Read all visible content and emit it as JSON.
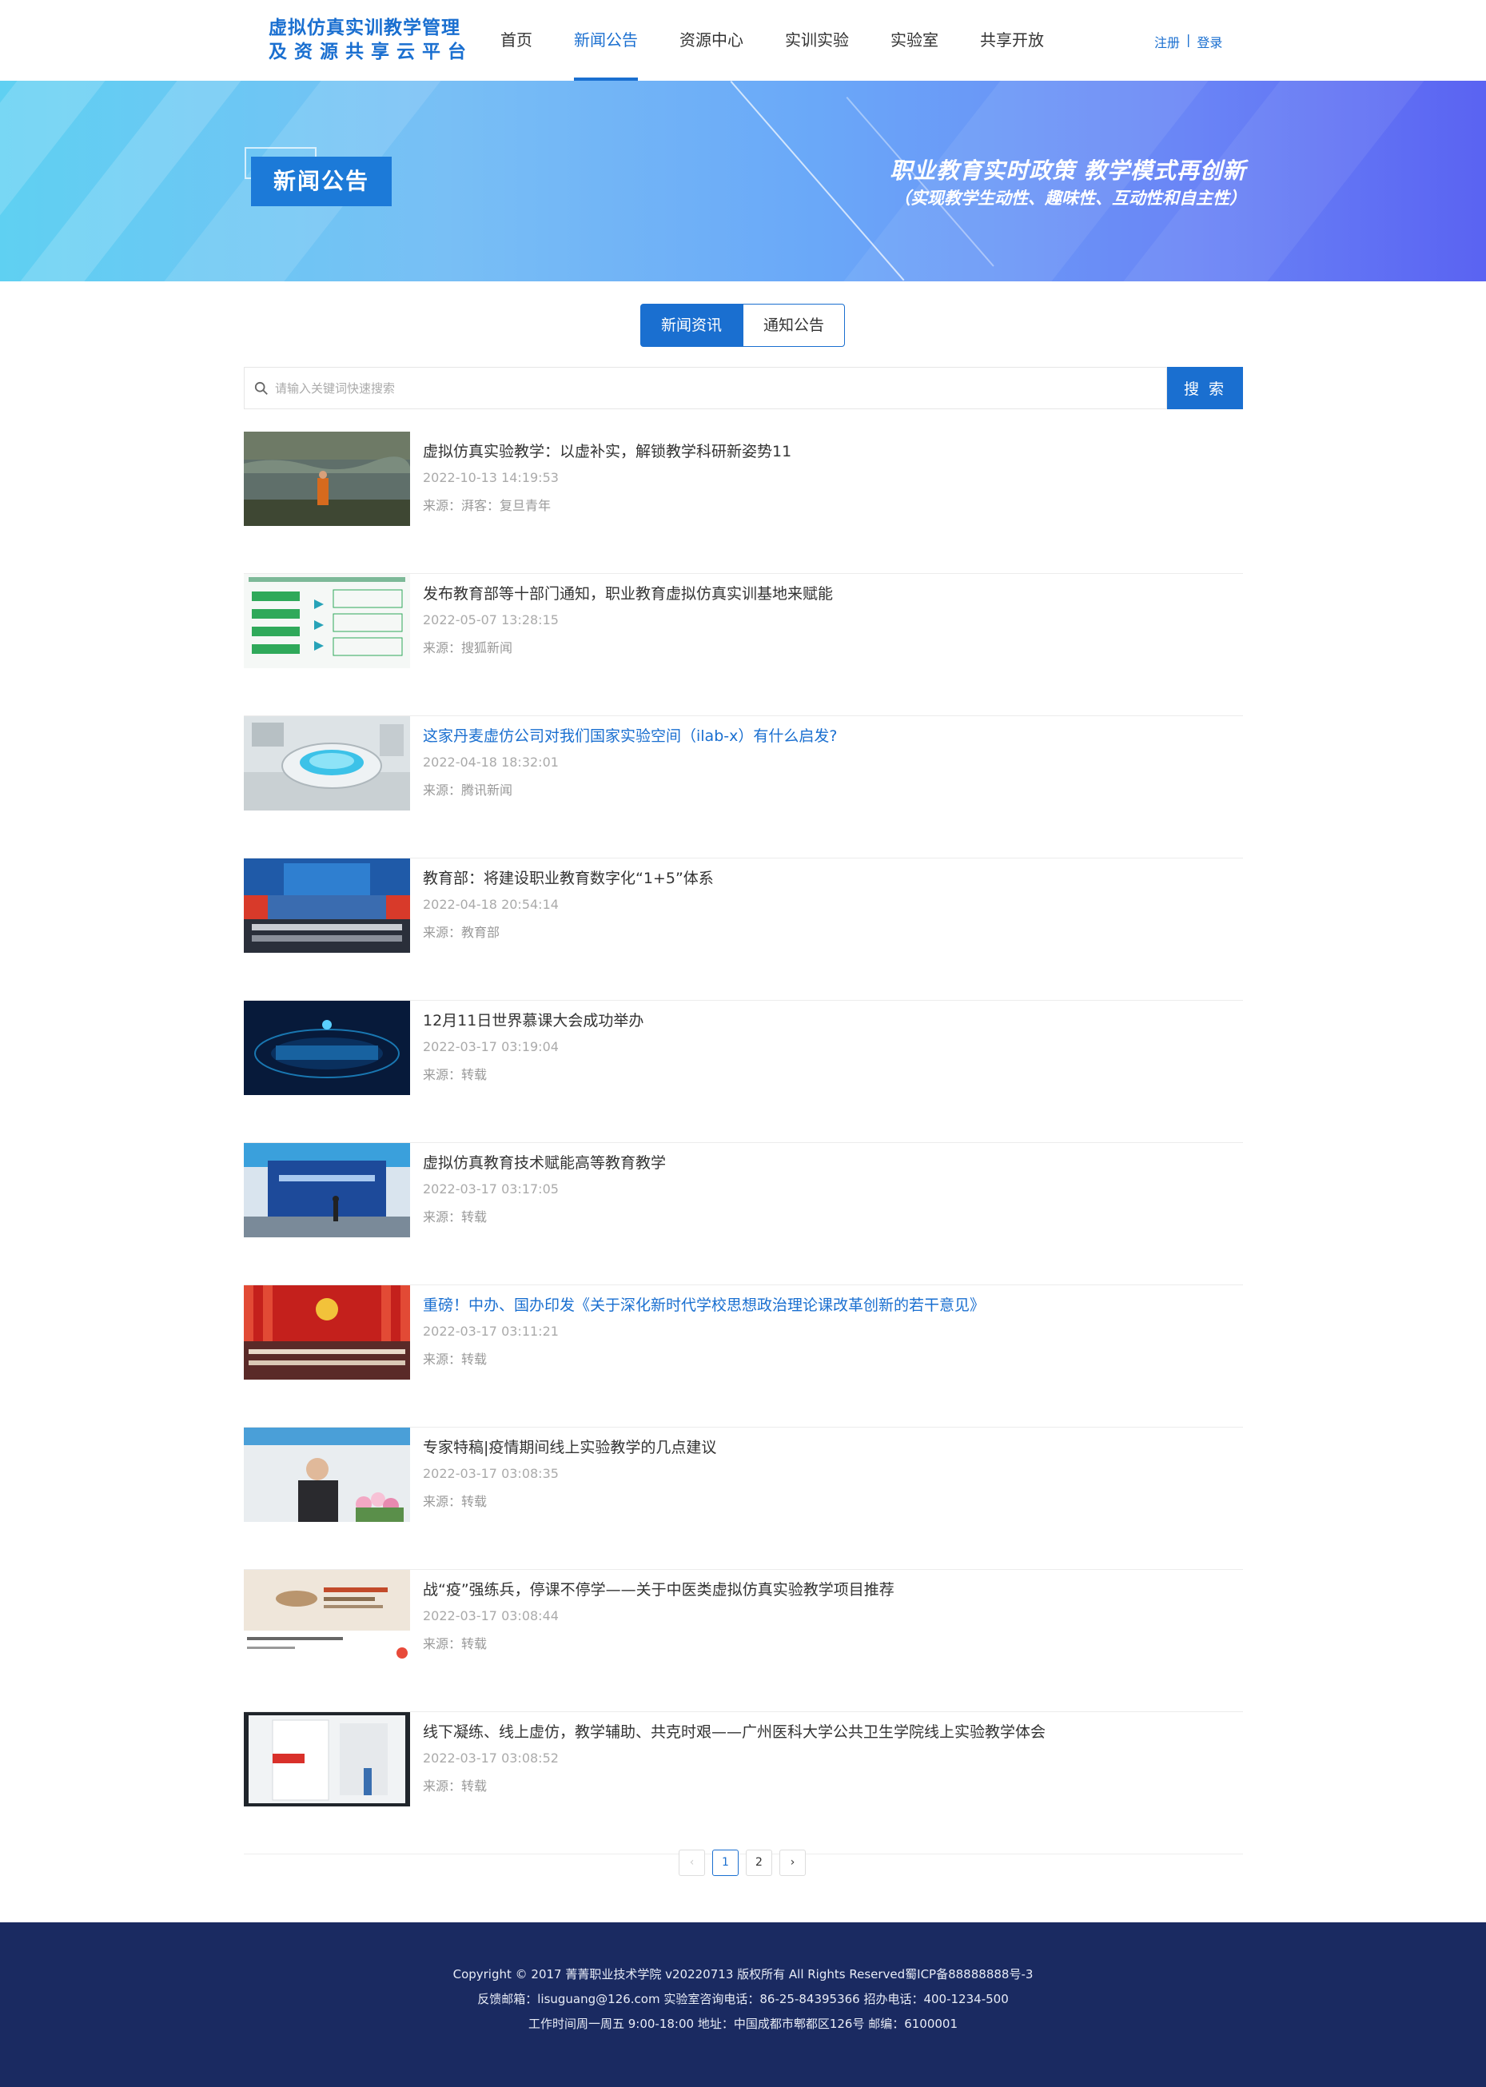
{
  "header": {
    "logo_line1": "虚拟仿真实训教学管理",
    "logo_line2": "及资源共享云平台",
    "nav": [
      {
        "label": "首页"
      },
      {
        "label": "新闻公告",
        "active": true
      },
      {
        "label": "资源中心"
      },
      {
        "label": "实训实验"
      },
      {
        "label": "实验室"
      },
      {
        "label": "共享开放"
      }
    ],
    "register": "注册",
    "separator": "|",
    "login": "登录"
  },
  "banner": {
    "tag": "新闻公告",
    "slogan_line1": "职业教育实时政策  教学模式再创新",
    "slogan_line2": "（实现教学生动性、趣味性、互动性和自主性）"
  },
  "tabs": {
    "news": "新闻资讯",
    "notice": "通知公告"
  },
  "search": {
    "placeholder": "请输入关键词快速搜索",
    "button": "搜 索"
  },
  "news_items": [
    {
      "title": "虚拟仿真实验教学：以虚补实，解锁教学科研新姿势11",
      "date": "2022-10-13 14:19:53",
      "source": "来源：湃客：复旦青年",
      "thumb": "lake-scene",
      "highlight": false
    },
    {
      "title": "发布教育部等十部门通知，职业教育虚拟仿真实训基地来赋能",
      "date": "2022-05-07 13:28:15",
      "source": "来源：搜狐新闻",
      "thumb": "flowchart",
      "highlight": false
    },
    {
      "title": "这家丹麦虚仿公司对我们国家实验空间（ilab-x）有什么启发?",
      "date": "2022-04-18 18:32:01",
      "source": "来源：腾讯新闻",
      "thumb": "lab-device",
      "highlight": true
    },
    {
      "title": "教育部：将建设职业教育数字化“1+5”体系",
      "date": "2022-04-18 20:54:14",
      "source": "来源：教育部",
      "thumb": "press-conference",
      "highlight": false
    },
    {
      "title": "12月11日世界慕课大会成功举办",
      "date": "2022-03-17 03:19:04",
      "source": "来源：转载",
      "thumb": "mooc-conference",
      "highlight": false
    },
    {
      "title": "虚拟仿真教育技术赋能高等教育教学",
      "date": "2022-03-17 03:17:05",
      "source": "来源：转载",
      "thumb": "mooc-stage",
      "highlight": false
    },
    {
      "title": "重磅！中办、国办印发《关于深化新时代学校思想政治理论课改革创新的若干意见》",
      "date": "2022-03-17 03:11:21",
      "source": "来源：转载",
      "thumb": "assembly-hall",
      "highlight": true
    },
    {
      "title": "专家特稿|疫情期间线上实验教学的几点建议",
      "date": "2022-03-17 03:08:35",
      "source": "来源：转载",
      "thumb": "speaker",
      "highlight": false
    },
    {
      "title": "战“疫”强练兵，停课不停学——关于中医类虚拟仿真实验教学项目推荐",
      "date": "2022-03-17 03:08:44",
      "source": "来源：转载",
      "thumb": "tcm-card",
      "highlight": false
    },
    {
      "title": "线下凝练、线上虚仿，教学辅助、共克时艰——广州医科大学公共卫生学院线上实验教学体会",
      "date": "2022-03-17 03:08:52",
      "source": "来源：转载",
      "thumb": "lab-coat",
      "highlight": false
    }
  ],
  "pagination": {
    "prev": "‹",
    "pages": [
      "1",
      "2"
    ],
    "current": "1",
    "next": "›"
  },
  "footer": {
    "line1": "Copyright © 2017 菁菁职业技术学院 v20220713 版权所有 All Rights Reserved蜀ICP备88888888号-3",
    "line2": "反馈邮箱：lisuguang@126.com 实验室咨询电话：86-25-84395366   招办电话：400-1234-500",
    "line3": "工作时间周一周五  9:00-18:00 地址：中国成都市郫都区126号 邮编：6100001"
  },
  "colors": {
    "brand": "#1a6fd0",
    "footer_bg": "#1a2a61"
  }
}
